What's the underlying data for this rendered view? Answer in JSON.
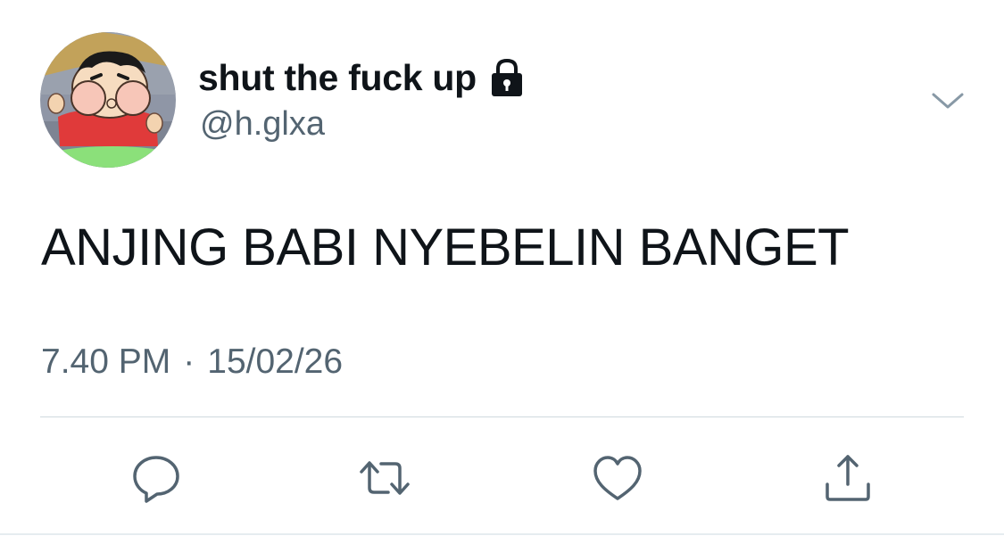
{
  "tweet": {
    "display_name": "shut the fuck up",
    "handle": "@h.glxa",
    "text": "ANJING BABI NYEBELIN BANGET",
    "time": "7.40 PM",
    "separator": "·",
    "date": "15/02/26"
  },
  "icons": {
    "lock": "lock-icon",
    "caret": "chevron-down-icon",
    "reply": "reply-icon",
    "retweet": "retweet-icon",
    "like": "heart-icon",
    "share": "share-icon"
  },
  "colors": {
    "text_primary": "#0f1419",
    "text_secondary": "#536471",
    "icon": "#536471",
    "divider": "#cfd9de"
  }
}
